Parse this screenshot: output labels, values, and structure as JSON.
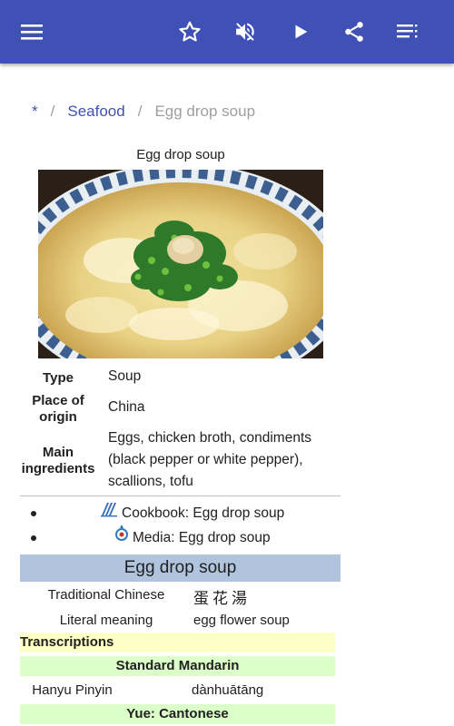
{
  "appbar": {
    "background": "#3f51b5",
    "icons": [
      "menu-icon",
      "star-outline-icon",
      "volume-off-icon",
      "play-icon",
      "share-icon",
      "playlist-icon"
    ]
  },
  "breadcrumb": {
    "root": "*",
    "category": "Seafood",
    "current": "Egg drop soup"
  },
  "infobox": {
    "caption": "Egg drop soup",
    "rows": [
      {
        "label": "Type",
        "value": "Soup"
      },
      {
        "label": "Place of origin",
        "value": "China"
      },
      {
        "label": "Main ingredients",
        "value_lines": [
          "Eggs, chicken broth, condiments",
          "(black pepper or white pepper),",
          "scallions, tofu"
        ]
      }
    ]
  },
  "links": [
    {
      "prefix": "Cookbook:",
      "text": "Egg drop soup",
      "icon": "wikibooks-icon"
    },
    {
      "prefix": "Media:",
      "text": "Egg drop soup",
      "icon": "commons-icon"
    }
  ],
  "chinese_box": {
    "header": "Egg drop soup",
    "header_color": "#b0c4de",
    "rows": [
      {
        "label": "Traditional Chinese",
        "value": "蛋花湯"
      },
      {
        "label": "Literal meaning",
        "value": "egg flower soup"
      }
    ],
    "transcriptions": "Transcriptions",
    "standard_mandarin": "Standard Mandarin",
    "pinyin_label": "Hanyu Pinyin",
    "pinyin_value": "dànhuātāng",
    "yue_cantonese": "Yue: Cantonese",
    "yellow_band_color": "#ffffc8",
    "green_band_color": "#dcffc9"
  }
}
